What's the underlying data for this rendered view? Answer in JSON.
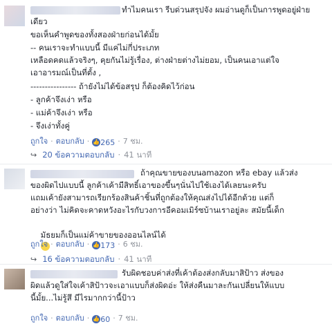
{
  "comments": [
    {
      "lines": [
        "ทำไมคนเรา รีบด่วนสรุปจัง ผมอ่านดูก็เป็นการพูดอยู่ฝ่าย",
        "เดียว",
        "ขอเห็นคำพูดของทั้งสองฝ่ายก่อนได้มั้ย",
        "-- คนเราจะทำแบบนี้ มีแค่ไม่กี่ประเภท",
        "เหลือดคดแล้วจริงๆ, คุยกันไม่รู้เรื่อง, ต่างฝ่ายต่างไม่ยอม, เป็นคนเอาแต่ใจ",
        "เอาอารมณ์เป็นที่ตั้ง ,",
        "---------------- ถ้ายังไม่ได้ข้อสรุป ก็ต้องคิดไว้ก่อน",
        "- ลูกค้าจึงเง่า หรือ",
        "- แม่ค้าจึงเง่า หรือ",
        "- จึงเง่าทั้งคู่"
      ],
      "actions": {
        "like": "ถูกใจ",
        "reply": "ตอบกลับ"
      },
      "like_count": "265",
      "time": "7 ชม.",
      "replies": {
        "label": "20 ข้อความตอบกลับ",
        "time": "41 นาที"
      }
    },
    {
      "lines": [
        "ถ้าคุณขายของบนamazon หรือ ebay แล้วส่ง",
        "ของผิดไปแบบนี้ ลูกค้าเค้ามีสิทธิ์เอาของขึ้นๆนั่นไปใช้เองได้เลยนะครับ",
        "แถมเค้ายังสามารถเรียกร้องสินค้าชิ้นที่ถูกต้องให้คุณส่งไปได้อีกด้วย แต่ก็",
        "อย่างว่า ไม่คิดจะคาดหวังอะไรกับวงการอีคอมเมิร์ซบ้านเราอยู่ละ สมัยนี้เด็ก",
        "มัธยมก็เป็นแม่ค้าขายของออนไลน์ได้"
      ],
      "actions": {
        "like": "ถูกใจ",
        "reply": "ตอบกลับ"
      },
      "like_count": "173",
      "time": "6 ชม.",
      "replies": {
        "label": "16 ข้อความตอบกลับ",
        "time": "41 นาที"
      }
    },
    {
      "lines": [
        "รับผิดชอบค่าส่งที่เค้าต้องส่งกลับมาสิป้าว ส่งของ",
        "ผิดแล้วดูใส่ใจเค้าสิป้าวจะเอาแบบก็ส่งผิดอ่ะ ให้ส่งคืนมาละกันเปลี่ยนให้แบบ",
        "นี้มั้ย...ไม่รู้สึ มีไรมากกว่านี้ป้าว"
      ],
      "actions": {
        "like": "ถูกใจ",
        "reply": "ตอบกลับ"
      },
      "like_count": "60",
      "time": "7 ชม."
    }
  ],
  "colors": {
    "link": "#4267b2",
    "muted": "#90949c",
    "text": "#1d2129"
  }
}
